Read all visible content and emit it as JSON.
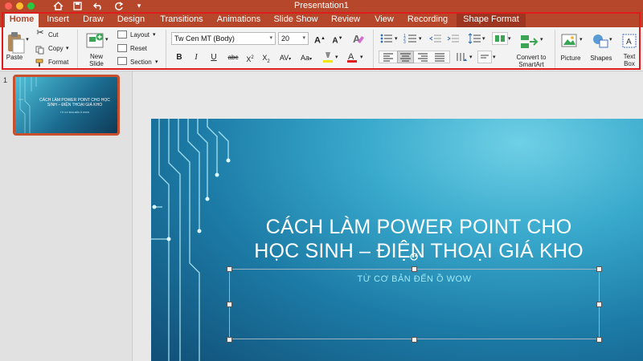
{
  "window": {
    "title": "Presentation1"
  },
  "titlebar_icons": [
    "home-icon",
    "save-icon",
    "undo-icon",
    "redo-icon",
    "more-icon"
  ],
  "tabs": [
    {
      "label": "Home",
      "active": true
    },
    {
      "label": "Insert"
    },
    {
      "label": "Draw"
    },
    {
      "label": "Design"
    },
    {
      "label": "Transitions"
    },
    {
      "label": "Animations"
    },
    {
      "label": "Slide Show"
    },
    {
      "label": "Review"
    },
    {
      "label": "View"
    },
    {
      "label": "Recording"
    },
    {
      "label": "Shape Format",
      "contextual": true
    }
  ],
  "ribbon": {
    "paste": "Paste",
    "cut": "Cut",
    "copy": "Copy",
    "format": "Format",
    "new_slide": "New\nSlide",
    "layout": "Layout",
    "reset": "Reset",
    "section": "Section",
    "font_name": "Tw Cen MT (Body)",
    "font_size": "20",
    "convert_smartart": "Convert to\nSmartArt",
    "picture": "Picture",
    "shapes": "Shapes",
    "text_box": "Text\nBox"
  },
  "colors": {
    "brand": "#b7472a",
    "highlight_bar": "#f2e600",
    "font_color_bar": "#e01b1b",
    "annotation": "#e01b1b"
  },
  "slides_panel": {
    "number": "1",
    "thumb_title": "CÁCH LÀM POWER POINT CHO HỌC SINH – ĐIỆN THOẠI GIÁ KHO",
    "thumb_subtitle": "TỪ CƠ BẢN ĐẾN Ồ WOW"
  },
  "slide": {
    "title_line1": "CÁCH LÀM POWER POINT CHO",
    "title_line2": "HỌC SINH – ĐIỆN THOẠI GIÁ KHO",
    "subtitle": "TỪ CƠ BẢN ĐẾN Ồ WOW"
  }
}
